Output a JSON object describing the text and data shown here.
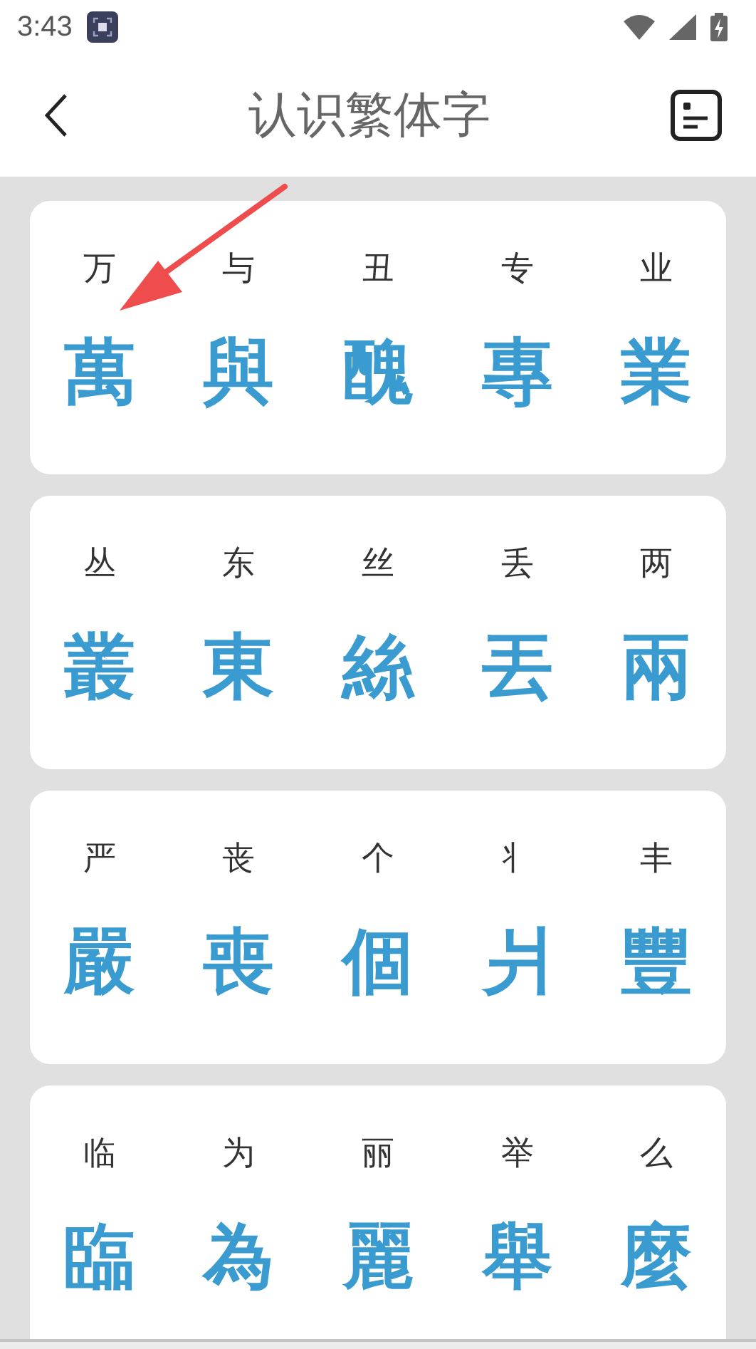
{
  "status_bar": {
    "time": "3:43"
  },
  "header": {
    "title": "认识繁体字"
  },
  "groups": [
    {
      "pairs": [
        {
          "simplified": "万",
          "traditional": "萬"
        },
        {
          "simplified": "与",
          "traditional": "與"
        },
        {
          "simplified": "丑",
          "traditional": "醜"
        },
        {
          "simplified": "专",
          "traditional": "專"
        },
        {
          "simplified": "业",
          "traditional": "業"
        }
      ]
    },
    {
      "pairs": [
        {
          "simplified": "丛",
          "traditional": "叢"
        },
        {
          "simplified": "东",
          "traditional": "東"
        },
        {
          "simplified": "丝",
          "traditional": "絲"
        },
        {
          "simplified": "丢",
          "traditional": "丟"
        },
        {
          "simplified": "两",
          "traditional": "兩"
        }
      ]
    },
    {
      "pairs": [
        {
          "simplified": "严",
          "traditional": "嚴"
        },
        {
          "simplified": "丧",
          "traditional": "喪"
        },
        {
          "simplified": "个",
          "traditional": "個"
        },
        {
          "simplified": "丬",
          "traditional": "爿"
        },
        {
          "simplified": "丰",
          "traditional": "豐"
        }
      ]
    },
    {
      "pairs": [
        {
          "simplified": "临",
          "traditional": "臨"
        },
        {
          "simplified": "为",
          "traditional": "為"
        },
        {
          "simplified": "丽",
          "traditional": "麗"
        },
        {
          "simplified": "举",
          "traditional": "舉"
        },
        {
          "simplified": "么",
          "traditional": "麼"
        }
      ]
    }
  ]
}
